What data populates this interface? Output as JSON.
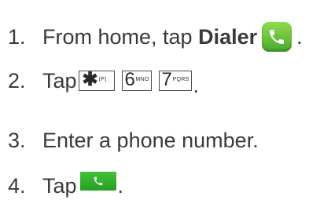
{
  "steps": [
    {
      "number": "1.",
      "text_pre": "From home, tap ",
      "text_bold": "Dialer",
      "icon": "phone-app-icon",
      "end": "."
    },
    {
      "number": "2.",
      "text_pre": "Tap",
      "keys": [
        {
          "main": "✱",
          "sub": "(P)"
        },
        {
          "main": "6",
          "sub": "MNO"
        },
        {
          "main": "7",
          "sub": "PQRS"
        }
      ],
      "end": "."
    },
    {
      "number": "3.",
      "text": "Enter a phone number."
    },
    {
      "number": "4.",
      "text_pre": "Tap",
      "icon": "call-button-icon",
      "end": "."
    }
  ],
  "colors": {
    "text": "#3a3a3a",
    "dialer_green": "#5cb832",
    "call_green": "#2fb22a"
  }
}
